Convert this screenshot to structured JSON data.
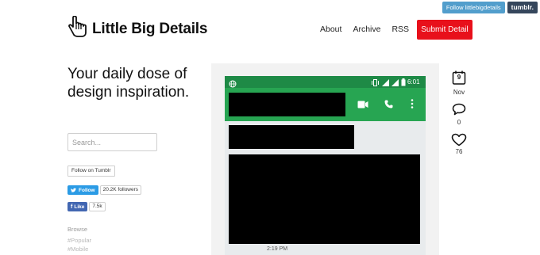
{
  "tumblr_bar": {
    "follow_label": "Follow littlebigdetails",
    "brand": "tumblr."
  },
  "header": {
    "title": "Little Big Details",
    "logo_icon": "hand-cursor-icon",
    "nav": [
      {
        "label": "About"
      },
      {
        "label": "Archive"
      },
      {
        "label": "RSS"
      }
    ],
    "submit_label": "Submit Detail",
    "accent_color": "#e8101b"
  },
  "sidebar": {
    "tagline": "Your daily dose of design inspiration.",
    "search_placeholder": "Search...",
    "follow_tumblr": "Follow on Tumblr",
    "twitter": {
      "label": "Follow",
      "count": "20.2K followers"
    },
    "facebook": {
      "label": "Like",
      "count": "7.5k"
    },
    "browse_label": "Browse",
    "tags": [
      "#Popular",
      "#Mobile"
    ]
  },
  "post": {
    "status_time": "6:01",
    "message_time": "2:19 PM",
    "toolbar_color": "#27a552",
    "statusbar_color": "#1e8a46"
  },
  "meta": {
    "day": "9",
    "month": "Nov",
    "comments": "0",
    "likes": "76"
  }
}
